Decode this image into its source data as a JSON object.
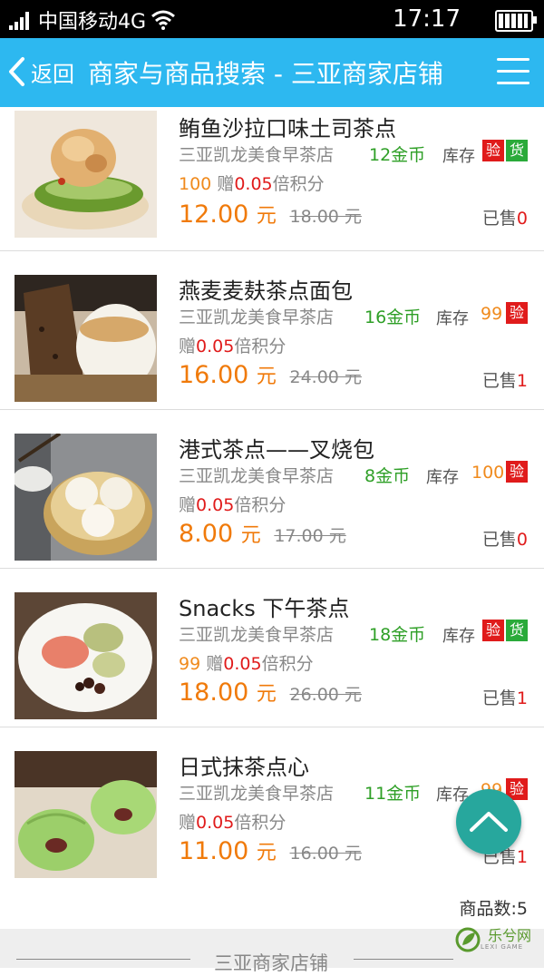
{
  "status_bar": {
    "carrier": "中国移动4G",
    "time": "17:17",
    "signal_icon": "signal-icon",
    "wifi_icon": "wifi-icon",
    "battery_icon": "battery-icon"
  },
  "nav": {
    "back_label": "返回",
    "title": "商家与商品搜索 - 三亚商家店铺",
    "background": "#2db8f0"
  },
  "items": [
    {
      "title": "鲔鱼沙拉口味土司茶点",
      "shop": "三亚凯龙美食早茶店",
      "coins": "12金币",
      "stock_label": "库存",
      "stock_value": "100",
      "badges": [
        "验",
        "货"
      ],
      "gift_label": "赠",
      "points_value": "0.05",
      "points_suffix": "倍积分",
      "price": "12.00",
      "price_unit": "元",
      "original_price": "18.00 元",
      "sold_label": "已售",
      "sold_count": "0"
    },
    {
      "title": "燕麦麦麸茶点面包",
      "shop": "三亚凯龙美食早茶店",
      "coins": "16金币",
      "stock_label": "库存",
      "stock_value": "99",
      "badges": [
        "验"
      ],
      "gift_label": "赠",
      "points_value": "0.05",
      "points_suffix": "倍积分",
      "price": "16.00",
      "price_unit": "元",
      "original_price": "24.00 元",
      "sold_label": "已售",
      "sold_count": "1"
    },
    {
      "title": "港式茶点——叉烧包",
      "shop": "三亚凯龙美食早茶店",
      "coins": "8金币",
      "stock_label": "库存",
      "stock_value": "100",
      "badges": [
        "验"
      ],
      "gift_label": "赠",
      "points_value": "0.05",
      "points_suffix": "倍积分",
      "price": "8.00",
      "price_unit": "元",
      "original_price": "17.00 元",
      "sold_label": "已售",
      "sold_count": "0"
    },
    {
      "title": "Snacks 下午茶点",
      "shop": "三亚凯龙美食早茶店",
      "coins": "18金币",
      "stock_label": "库存",
      "stock_value": "99",
      "badges": [
        "验",
        "货"
      ],
      "gift_label": "赠",
      "points_value": "0.05",
      "points_suffix": "倍积分",
      "price": "18.00",
      "price_unit": "元",
      "original_price": "26.00 元",
      "sold_label": "已售",
      "sold_count": "1"
    },
    {
      "title": "日式抹茶点心",
      "shop": "三亚凯龙美食早茶店",
      "coins": "11金币",
      "stock_label": "库存",
      "stock_value": "99",
      "badges": [
        "验"
      ],
      "gift_label": "赠",
      "points_value": "0.05",
      "points_suffix": "倍积分",
      "price": "11.00",
      "price_unit": "元",
      "original_price": "16.00 元",
      "sold_label": "已售",
      "sold_count": "1"
    }
  ],
  "product_count": {
    "label": "商品数:",
    "value": "5"
  },
  "footer": {
    "section_title": "三亚商家店铺"
  },
  "back_to_top": {
    "icon": "chevron-up-icon",
    "color": "#27a79d"
  },
  "watermark": {
    "text": "乐兮网",
    "sub": "LEXI GAME"
  },
  "colors": {
    "price": "#f07a0a",
    "coins": "#2e9f26",
    "badge_red": "#e01b1b",
    "badge_green": "#2aaa3a",
    "points": "#e01b1b"
  }
}
